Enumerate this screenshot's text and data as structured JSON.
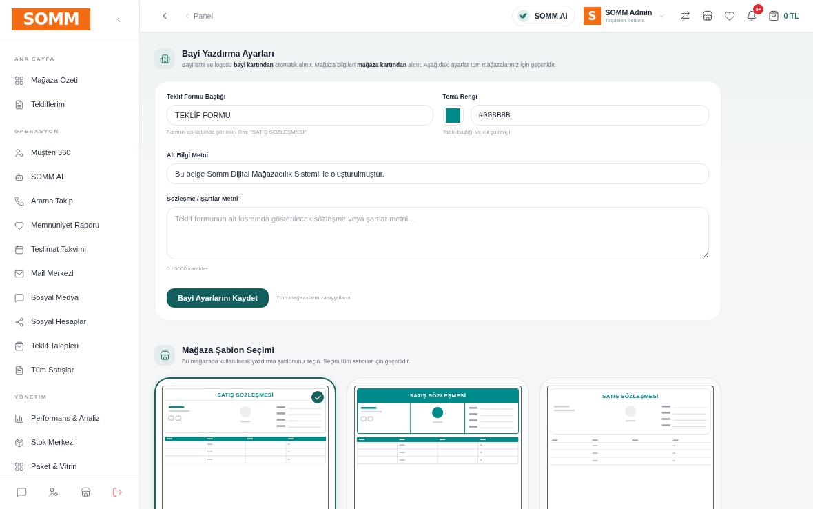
{
  "sidebar": {
    "logo": "SOMM",
    "sections": [
      {
        "title": "ANA SAYFA",
        "items": [
          "Mağaza Özeti",
          "Tekliflerim"
        ]
      },
      {
        "title": "OPERASYON",
        "items": [
          "Müşteri 360",
          "SOMM AI",
          "Arama Takip",
          "Memnuniyet Raporu",
          "Teslimat Takvimi",
          "Mail Merkezi",
          "Sosyal Medya",
          "Sosyal Hesaplar",
          "Teklif Talepleri",
          "Tüm Satışlar"
        ]
      },
      {
        "title": "YÖNETİM",
        "items": [
          "Performans & Analiz",
          "Stok Merkezi",
          "Paket & Vitrin"
        ]
      }
    ]
  },
  "header": {
    "breadcrumb": "Panel",
    "ai_button": "SOMM AI",
    "user": {
      "avatar": "S",
      "name": "SOMM Admin",
      "store": "Taşdelen Bellona"
    },
    "notification_count": "9+",
    "cart_total": "0 TL"
  },
  "print_settings": {
    "title": "Bayi Yazdırma Ayarları",
    "description": "Bayi ismi ve logosu **bayi kartından** otomatik alınır. Mağaza bilgileri **mağaza kartından** alınır. Aşağıdaki ayarlar tüm mağazalarınız için geçerlidir.",
    "form_title": {
      "label": "Teklif Formu Başlığı",
      "value": "TEKLİF FORMU",
      "hint": "Formun en üstünde görünür. Örn: \"SATIŞ SÖZLEŞMESİ\""
    },
    "theme_color": {
      "label": "Tema Rengi",
      "value": "#008B8B",
      "hint": "Tablo başlığı ve vurgu rengi"
    },
    "footer_text": {
      "label": "Alt Bilgi Metni",
      "value": "Bu belge Somm Dijital Mağazacılık Sistemi ile oluşturulmuştur."
    },
    "terms_text": {
      "label": "Sözleşme / Şartlar Metni",
      "placeholder": "Teklif formunun alt kısmında gösterilecek sözleşme veya şartlar metni...",
      "counter": "0 / 5000 karakter"
    },
    "save_button": "Bayi Ayarlarını Kaydet",
    "save_note": "Tüm mağazalarınıza uygulanır"
  },
  "template_selection": {
    "title": "Mağaza Şablon Seçimi",
    "description": "Bu mağazada kullanılacak yazdırma şablonunu seçin. Seçim tüm satıcılar için geçerlidir.",
    "templates": [
      {
        "kind": "classic",
        "title": "SATIŞ SÖZLEŞMESİ",
        "selected": true
      },
      {
        "kind": "banner",
        "title": "SATIŞ SÖZLEŞMESİ",
        "selected": false
      },
      {
        "kind": "minimal",
        "title": "SATIŞ SÖZLEŞMESİ",
        "selected": false
      }
    ]
  }
}
